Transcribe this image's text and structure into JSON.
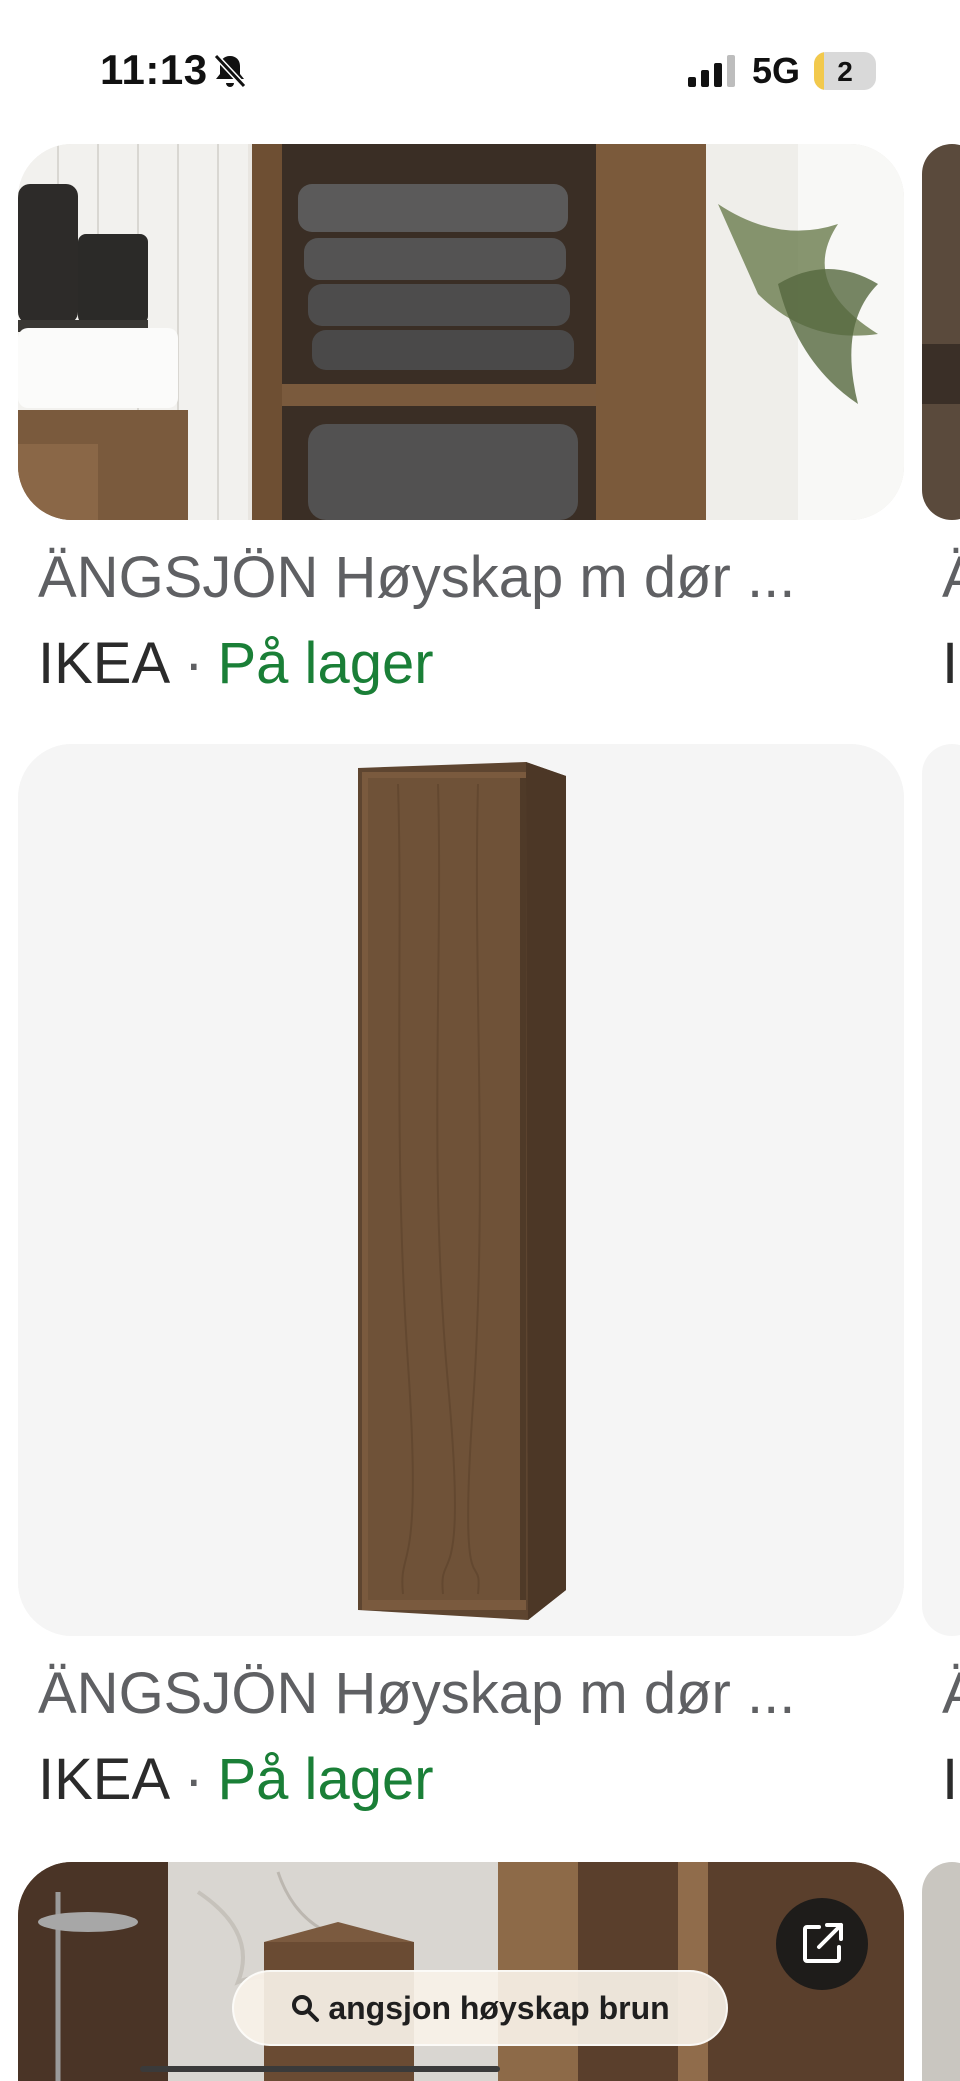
{
  "status_bar": {
    "time": "11:13",
    "network": "5G",
    "battery": "2",
    "icons": [
      "bell-slash-icon",
      "signal-icon",
      "battery-icon"
    ]
  },
  "results": [
    {
      "title": "ÄNGSJÖN Høyskap m dør ...",
      "store": "IKEA",
      "separator": "·",
      "availability": "På lager"
    },
    {
      "title": "ÄNGSJÖN Høyskap m dør ...",
      "store": "IKEA",
      "separator": "·",
      "availability": "På lager"
    }
  ],
  "peek_results": [
    {
      "title": "Ä",
      "store": "I"
    },
    {
      "title": "Ä",
      "store": "I"
    }
  ],
  "search_pill": {
    "query": "angsjon høyskap brun",
    "icon": "search-icon"
  },
  "colors": {
    "availability": "#1a7f37",
    "title": "#5f6063",
    "wood": "#6b4f36"
  }
}
